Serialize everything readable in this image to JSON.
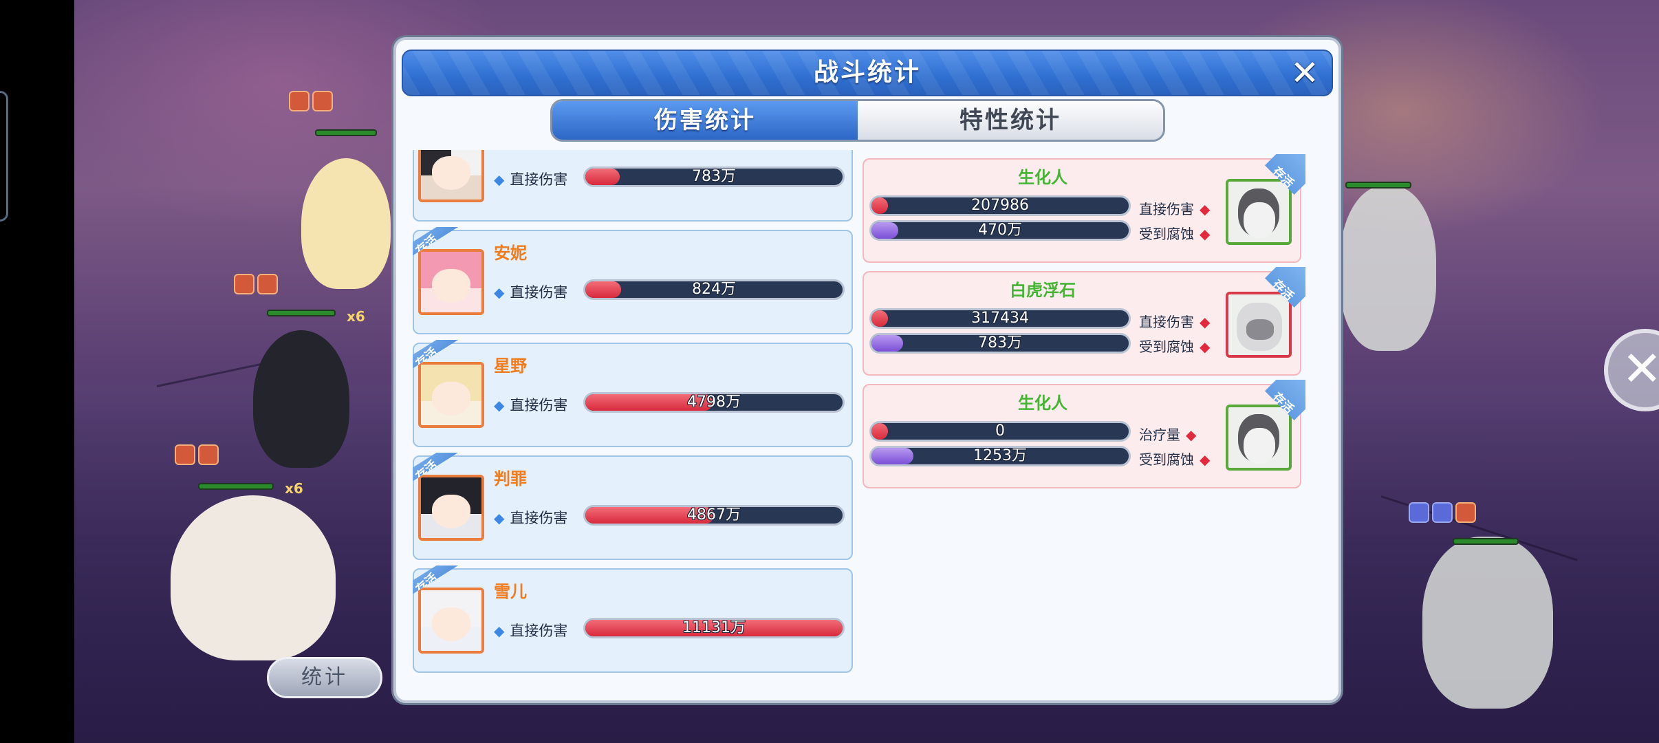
{
  "panel": {
    "title": "战斗统计",
    "close_symbol": "✕",
    "tabs": [
      {
        "label": "伤害统计",
        "active": true
      },
      {
        "label": "特性统计",
        "active": false
      }
    ]
  },
  "alive_tag": "存活",
  "allies": [
    {
      "name": "",
      "stat_label": "直接伤害",
      "value": "783万",
      "fraction": 0.07,
      "portrait": "black-white-hair"
    },
    {
      "name": "安妮",
      "stat_label": "直接伤害",
      "value": "824万",
      "fraction": 0.074,
      "portrait": "pink-hair"
    },
    {
      "name": "星野",
      "stat_label": "直接伤害",
      "value": "4798万",
      "fraction": 0.431,
      "portrait": "blonde-hair"
    },
    {
      "name": "判罪",
      "stat_label": "直接伤害",
      "value": "4867万",
      "fraction": 0.437,
      "portrait": "black-hair"
    },
    {
      "name": "雪儿",
      "stat_label": "直接伤害",
      "value": "11131万",
      "fraction": 1.0,
      "portrait": "white-hair"
    }
  ],
  "enemies": [
    {
      "name": "生化人",
      "portrait_border": "green",
      "stats": [
        {
          "label": "直接伤害",
          "value": "207986",
          "fraction": 0.0,
          "color": "red"
        },
        {
          "label": "受到腐蚀",
          "value": "470万",
          "fraction": 0.04,
          "color": "purple"
        }
      ]
    },
    {
      "name": "白虎浮石",
      "portrait_border": "red",
      "stats": [
        {
          "label": "直接伤害",
          "value": "317434",
          "fraction": 0.0,
          "color": "red"
        },
        {
          "label": "受到腐蚀",
          "value": "783万",
          "fraction": 0.06,
          "color": "purple"
        }
      ]
    },
    {
      "name": "生化人",
      "portrait_border": "green",
      "stats": [
        {
          "label": "治疗量",
          "value": "0",
          "fraction": 0.0,
          "color": "red"
        },
        {
          "label": "受到腐蚀",
          "value": "1253万",
          "fraction": 0.1,
          "color": "purple"
        }
      ]
    }
  ],
  "scene": {
    "stats_button": "统计",
    "multiplier_labels": [
      "x6",
      "x6"
    ]
  },
  "colors": {
    "title_blue": "#2f6fd0",
    "ally_name": "#f07c20",
    "enemy_name": "#46b536",
    "damage_fill": "#d8293c",
    "corrosion_fill": "#7b4fd8"
  }
}
